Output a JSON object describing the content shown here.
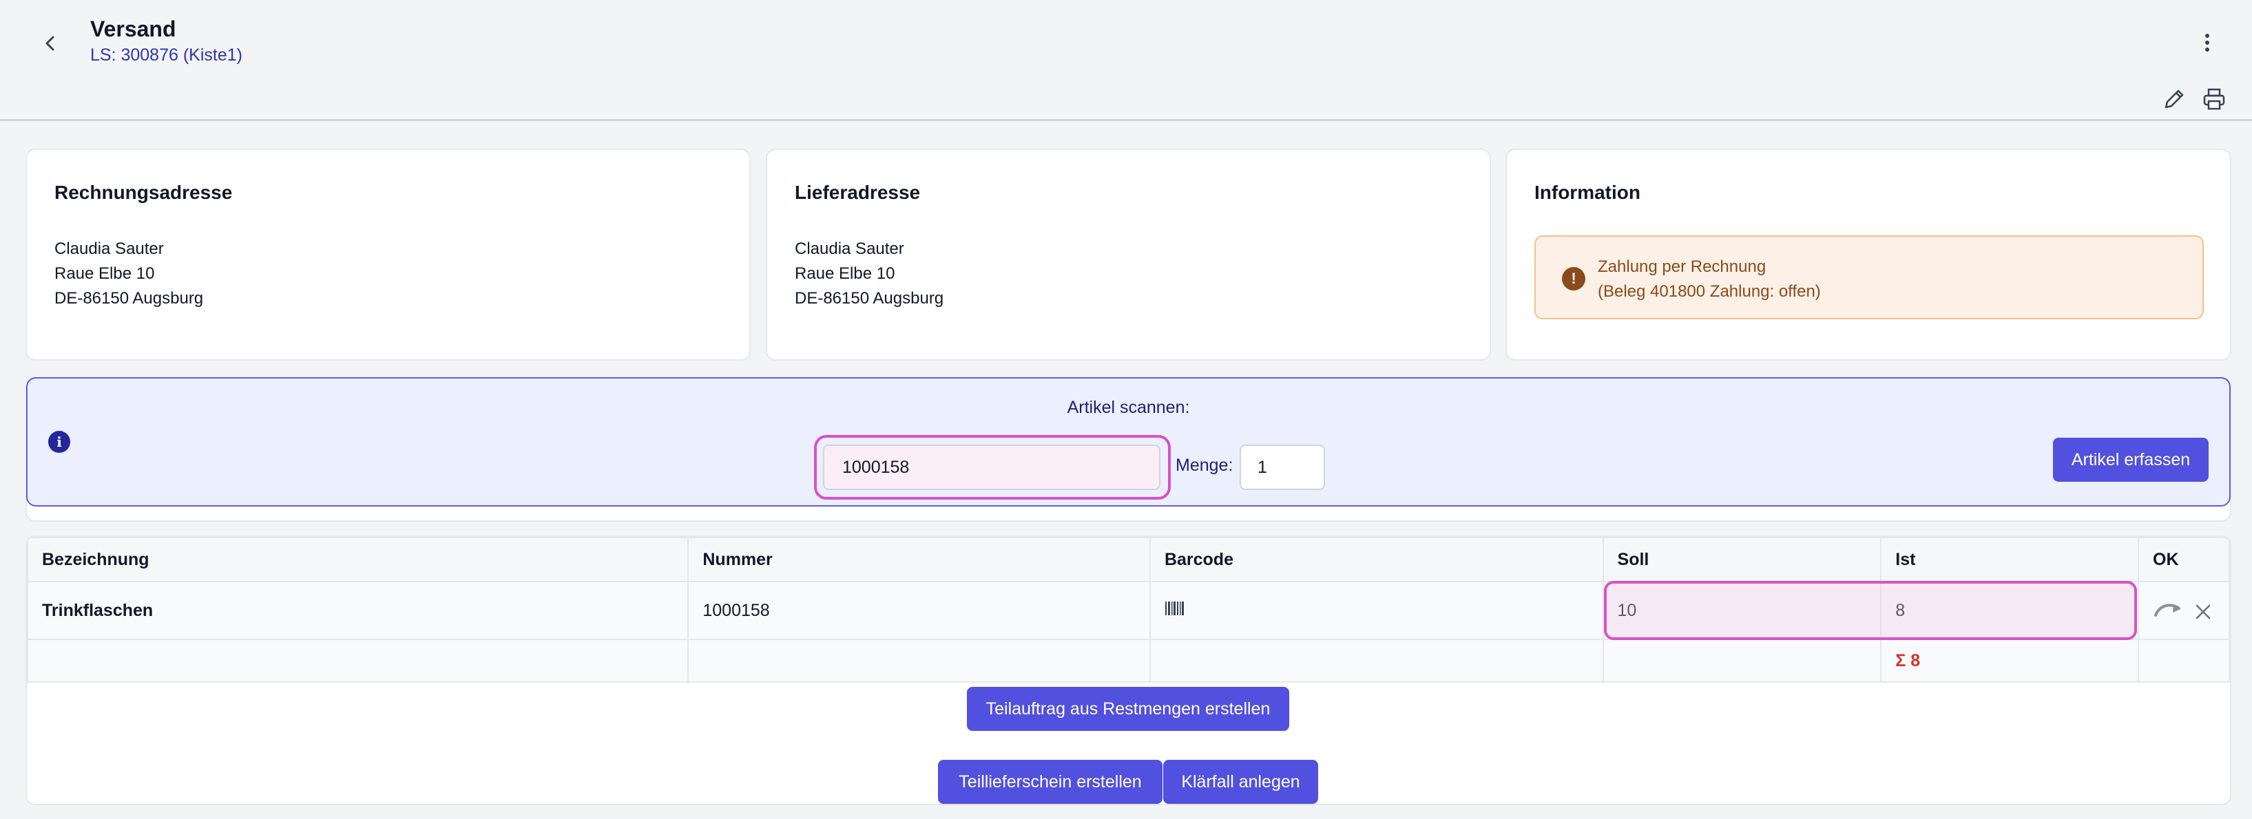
{
  "header": {
    "title": "Versand",
    "subtitle": "LS: 300876 (Kiste1)"
  },
  "cards": {
    "billing": {
      "title": "Rechnungsadresse",
      "lines": [
        "Claudia Sauter",
        "Raue Elbe 10",
        "DE-86150 Augsburg"
      ]
    },
    "delivery": {
      "title": "Lieferadresse",
      "lines": [
        "Claudia Sauter",
        "Raue Elbe 10",
        "DE-86150 Augsburg"
      ]
    },
    "info": {
      "title": "Information",
      "alert_icon": "!",
      "alert_lines": [
        "Zahlung per Rechnung",
        "(Beleg 401800 Zahlung: offen)"
      ]
    }
  },
  "scan": {
    "label": "Artikel scannen:",
    "info_icon": "i",
    "article_value": "1000158",
    "menge_label": "Menge:",
    "menge_value": "1",
    "submit_label": "Artikel erfassen"
  },
  "table": {
    "headers": [
      "Bezeichnung",
      "Nummer",
      "Barcode",
      "Soll",
      "Ist",
      "OK"
    ],
    "rows": [
      {
        "bezeichnung": "Trinkflaschen",
        "nummer": "1000158",
        "soll": "10",
        "ist": "8"
      }
    ],
    "sum_ist": "Σ 8"
  },
  "actions": {
    "teilauftrag": "Teilauftrag aus Restmengen erstellen",
    "teillieferschein": "Teillieferschein erstellen",
    "klaerfall": "Klärfall anlegen"
  },
  "icons": {
    "back": "chevron-left-icon",
    "menu": "kebab-menu-icon",
    "edit": "pencil-icon",
    "print": "printer-icon",
    "barcode": "barcode-icon",
    "redo": "redo-arrow-icon",
    "close": "close-icon"
  },
  "colors": {
    "primary": "#5250de",
    "highlight": "#d653c9",
    "warning_bg": "#fdf0e6",
    "sum": "#d0342c"
  }
}
